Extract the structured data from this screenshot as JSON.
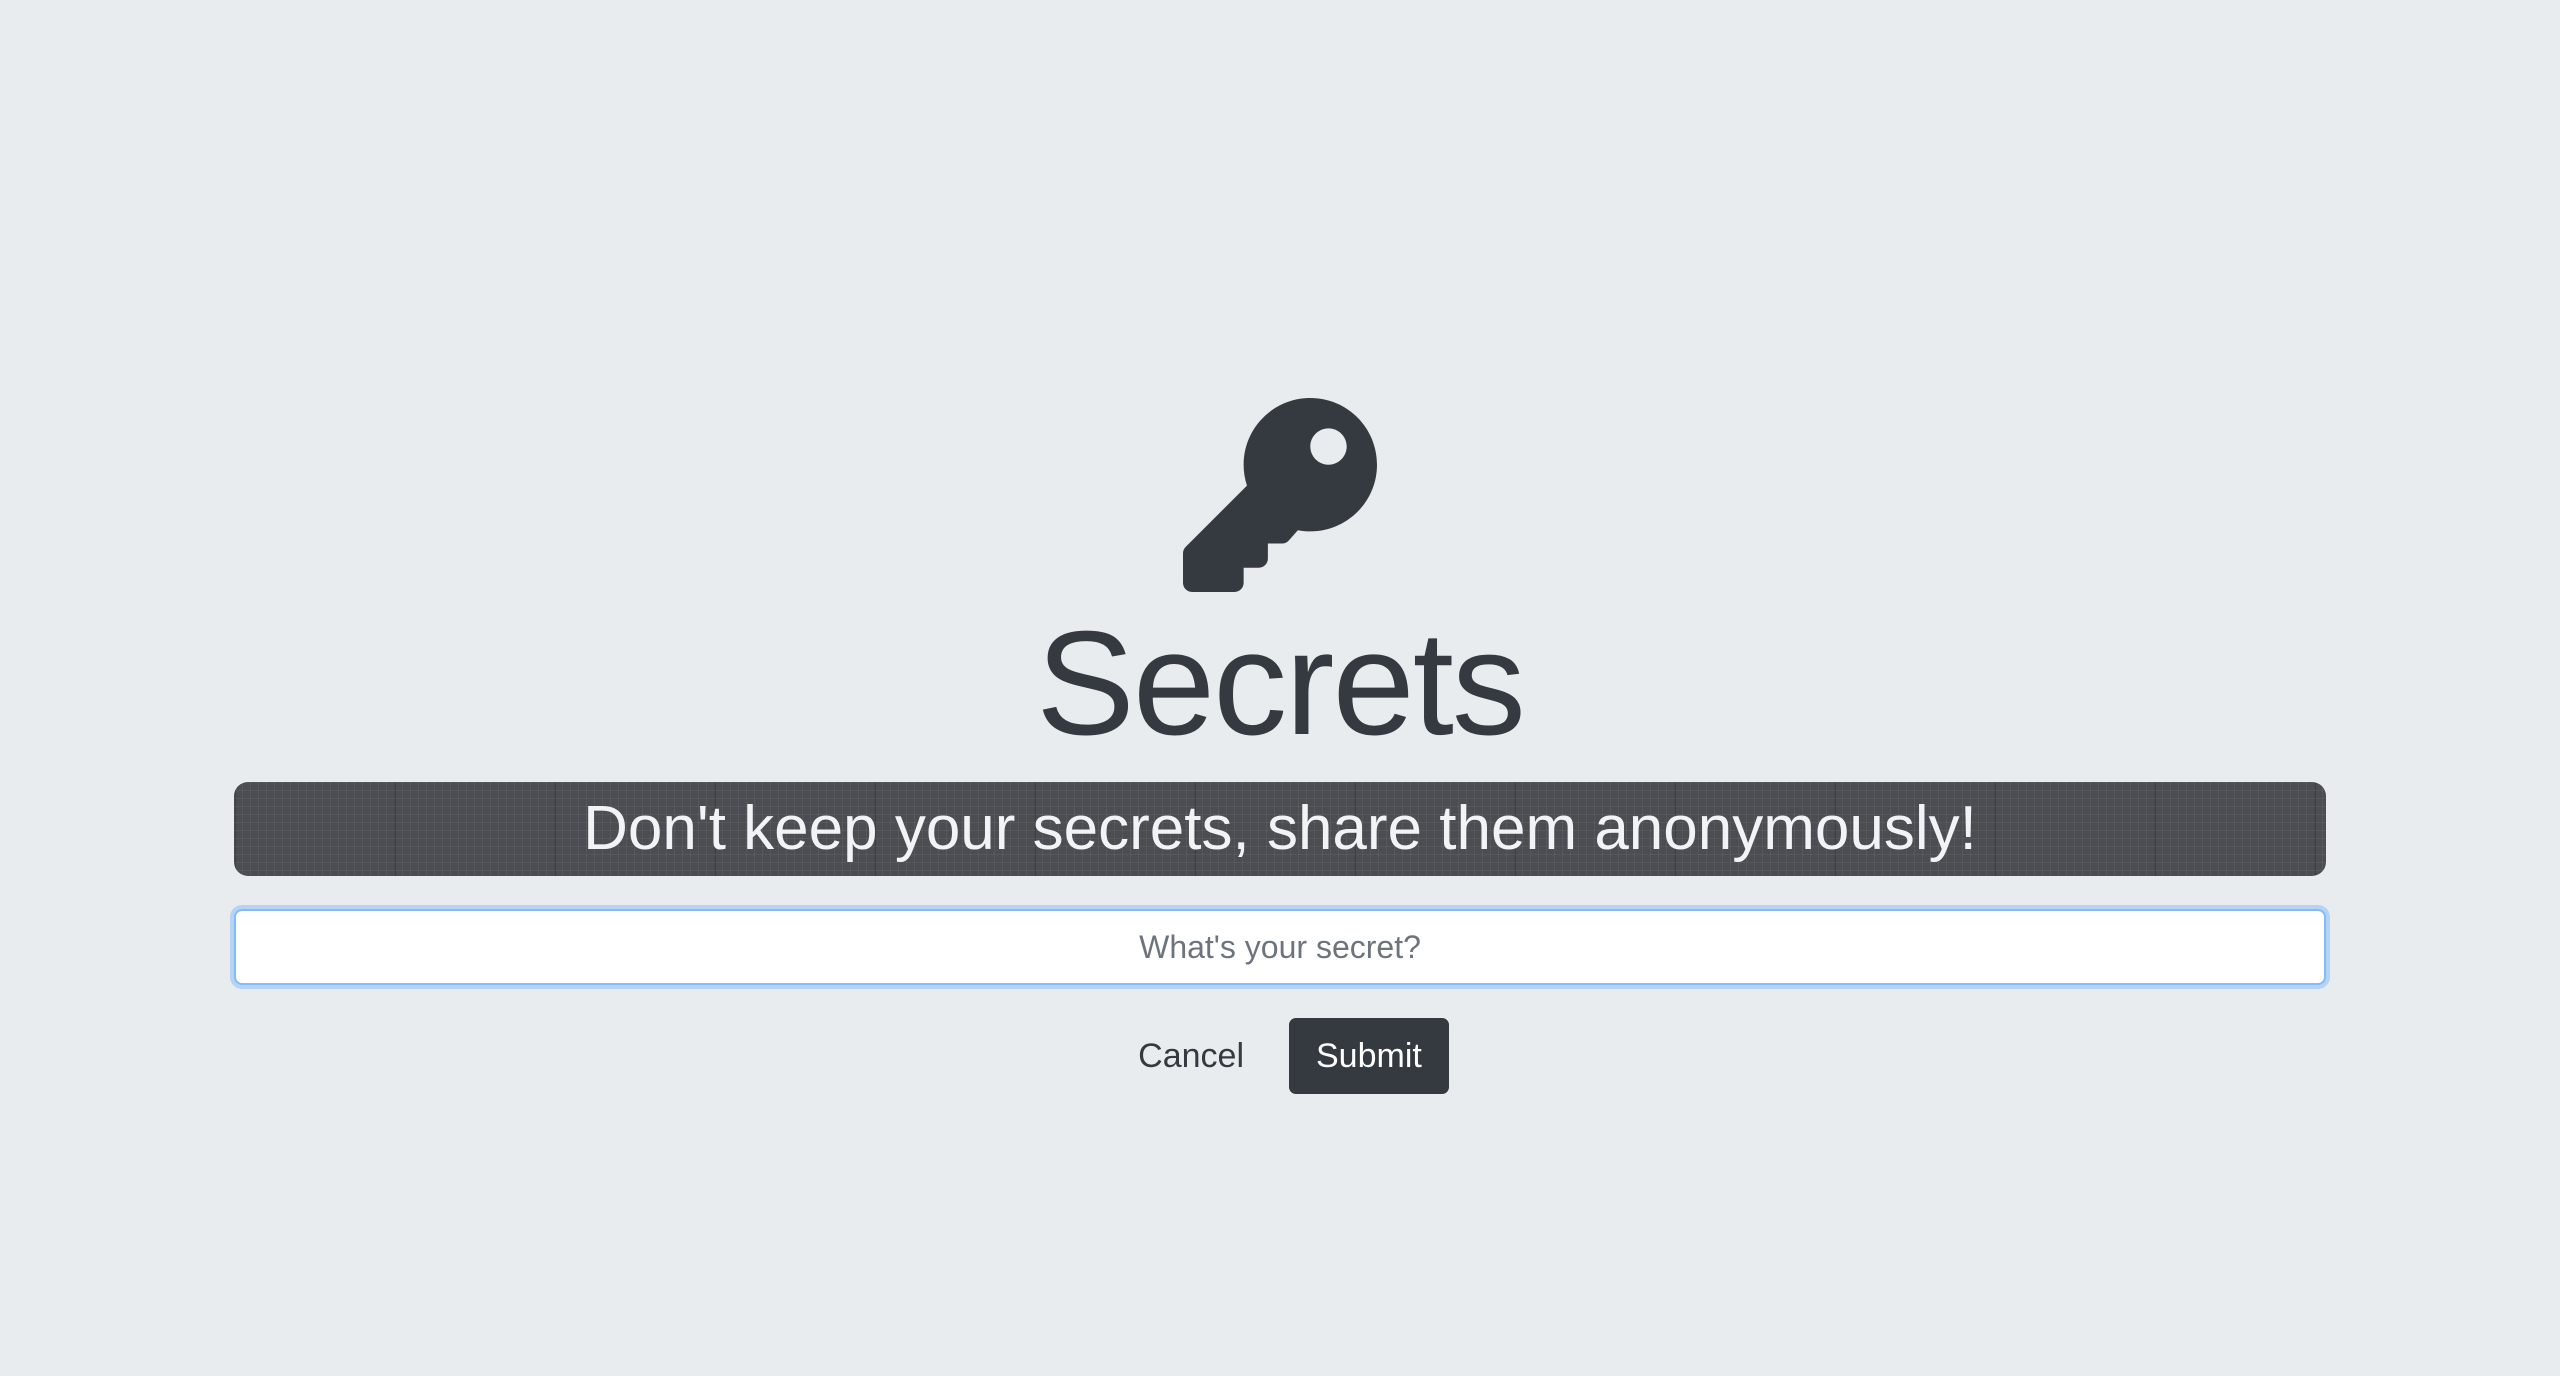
{
  "header": {
    "icon": "key-icon",
    "title": "Secrets",
    "tagline": "Don't keep your secrets, share them anonymously!"
  },
  "form": {
    "secret_placeholder": "What's your secret?",
    "secret_value": "",
    "cancel_label": "Cancel",
    "submit_label": "Submit"
  },
  "colors": {
    "background": "#e9ecef",
    "primary_dark": "#343a40",
    "banner": "#4a4d52",
    "focus_ring": "#80bdff"
  }
}
